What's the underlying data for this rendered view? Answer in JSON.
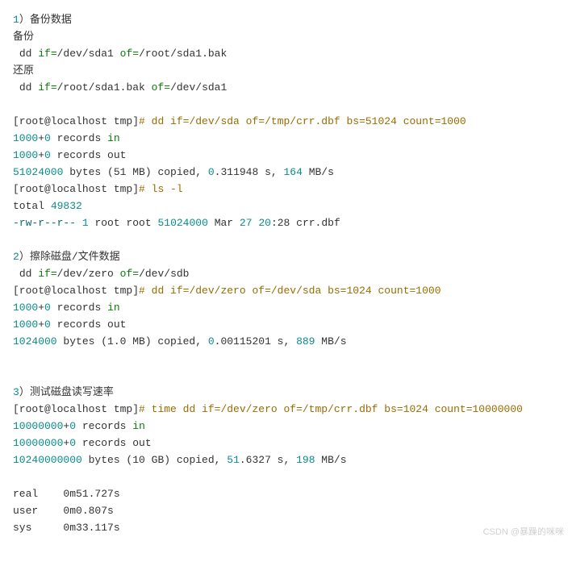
{
  "section1": {
    "num": "1",
    "paren": "）",
    "title": "备份数据",
    "backup_label": "备份",
    "dd_prefix": " dd ",
    "if_eq": "if=",
    "path_sda1": "/dev/sda1",
    "of_eq": " of=",
    "path_bak": "/root/sda1.bak",
    "restore_label": "还原",
    "prompt": "[root@localhost tmp]",
    "hash": "# ",
    "cmd1": "dd if=/dev/sda of=/tmp/crr.dbf bs=51024 count=1000",
    "rec_1000": "1000",
    "plus": "+",
    "zero": "0",
    "records_in": " records ",
    "in": "in",
    "records_out": " records out",
    "bytes_line_a": "51024000",
    "bytes_line_b": " bytes (51 MB) copied, ",
    "bytes_line_c": "0",
    "bytes_line_d": ".311948 s, ",
    "rate1": "164",
    "mbps": " MB/s",
    "cmd2": "ls -l",
    "total": "total ",
    "total_n": "49832",
    "perm": "-rw-r--r--",
    "sp": " ",
    "one": "1",
    "rootroot": " root root ",
    "size": "51024000",
    "mar": " Mar ",
    "d27": "27",
    "sp2": " ",
    "h20": "20",
    "colon_fname": ":28 crr.dbf"
  },
  "section2": {
    "num": "2",
    "paren": "）",
    "title": "擦除磁盘/文件数据",
    "dd_prefix": " dd ",
    "if_eq": "if=",
    "path_zero": "/dev/zero",
    "of_eq": " of=",
    "path_sdb": "/dev/sdb",
    "prompt": "[root@localhost tmp]",
    "hash": "# ",
    "cmd": "dd if=/dev/zero of=/dev/sda bs=1024 count=1000",
    "rec_1000": "1000",
    "plus": "+",
    "zero": "0",
    "records_in": " records ",
    "in": "in",
    "records_out": " records out",
    "bytes_a": "1024000",
    "bytes_b": " bytes (1.0 MB) copied, ",
    "bytes_c": "0",
    "bytes_d": ".00115201 s, ",
    "rate": "889",
    "mbps": " MB/s"
  },
  "section3": {
    "num": "3",
    "paren": "）",
    "title": "测试磁盘读写速率",
    "prompt": "[root@localhost tmp]",
    "hash": "# ",
    "cmd_a": "time dd if=/dev/zero of=/tmp/crr.dbf bs=1024 count=10000000",
    "rec_10m": "10000000",
    "plus": "+",
    "zero": "0",
    "records_in": " records ",
    "in": "in",
    "records_out": " records out",
    "bytes_a": "10240000000",
    "bytes_b": " bytes (10 GB) copied, ",
    "bytes_c": "51",
    "bytes_d": ".6327 s, ",
    "rate": "198",
    "mbps": " MB/s",
    "real": "real    0m51.727s",
    "user": "user    0m0.807s",
    "sys": "sys     0m33.117s"
  },
  "watermark": "CSDN @暴躁的咪咪"
}
